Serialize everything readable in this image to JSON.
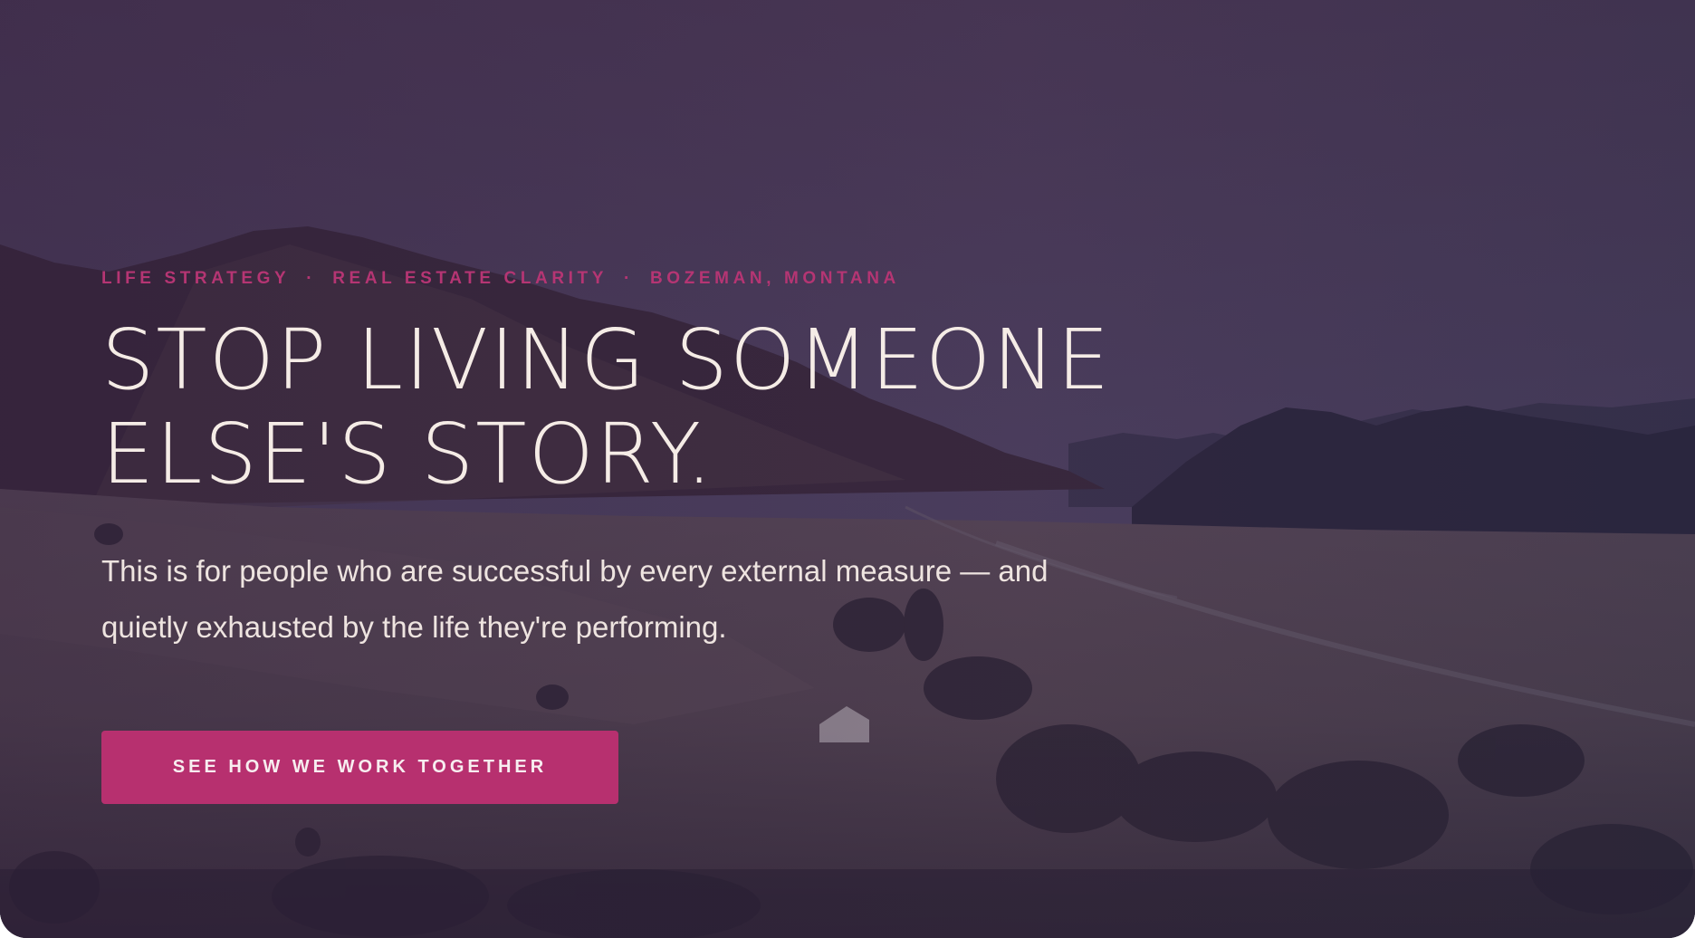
{
  "hero": {
    "eyebrow": {
      "items": [
        "LIFE STRATEGY",
        "REAL ESTATE CLARITY",
        "BOZEMAN, MONTANA"
      ],
      "separator": "·"
    },
    "headline": {
      "line1": "STOP LIVING SOMEONE",
      "line2": "ELSE'S STORY."
    },
    "subtext": "This is for people who are successful by every external measure — and quietly exhausted by the life they're performing.",
    "cta_label": "SEE HOW WE WORK TOGETHER",
    "colors": {
      "accent": "#b7306f",
      "eyebrow": "#b53573",
      "headline": "#f5ece6",
      "overlay": "#45384f"
    },
    "background": "aerial-mountain-valley-image"
  }
}
